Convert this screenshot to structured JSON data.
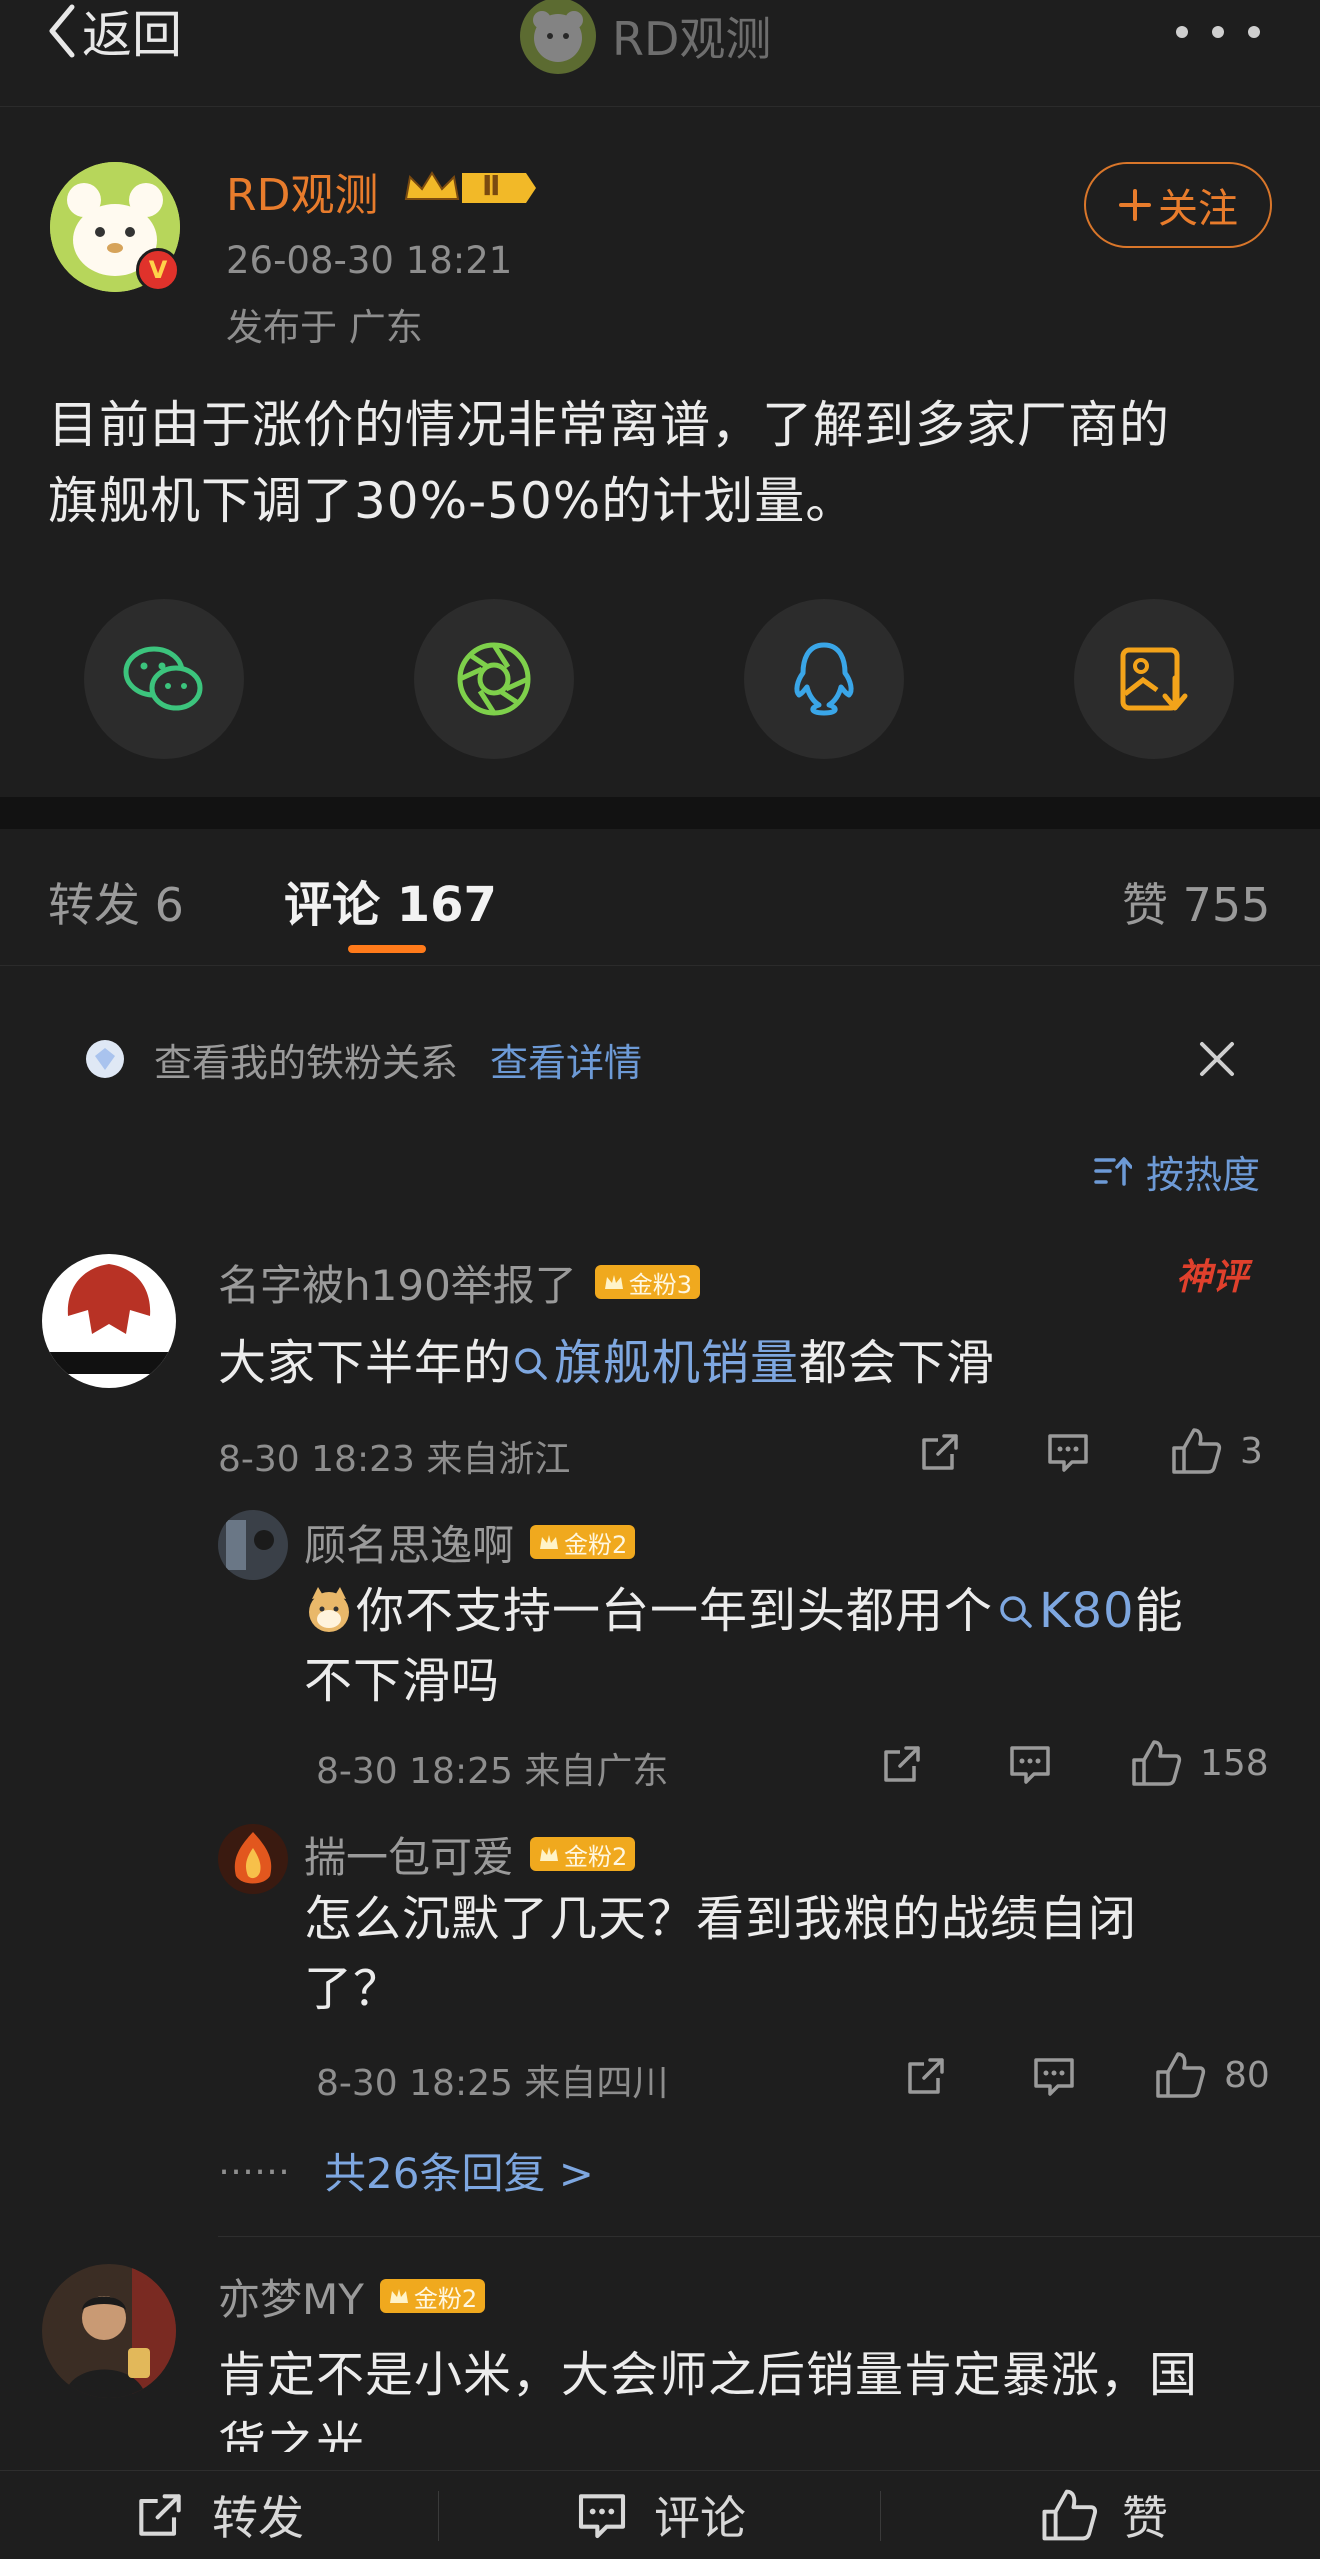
{
  "header": {
    "back_label": "返回",
    "title": "RD观测"
  },
  "post": {
    "author": "RD观测",
    "rank": "Ⅱ",
    "time": "26-08-30 18:21",
    "location": "发布于 广东",
    "follow_label": "关注",
    "text_line1": "目前由于涨价的情况非常离谱，了解到多家厂商的",
    "text_line2": "旗舰机下调了30%-50%的计划量。",
    "share_targets": [
      "wechat-icon",
      "moments-icon",
      "qq-icon",
      "save-image-icon"
    ]
  },
  "tabs": {
    "repost": "转发 6",
    "comment": "评论 167",
    "like": "赞 755"
  },
  "fan_notice": {
    "text": "查看我的铁粉关系",
    "link": "查看详情"
  },
  "sort_label": "按热度",
  "comments": [
    {
      "user": "名字被h190举报了",
      "badge": "金粉3",
      "tag": "神评",
      "text_pre": "大家下半年的",
      "topic": "旗舰机销量",
      "text_post": "都会下滑",
      "meta": "8-30 18:23 来自浙江",
      "likes": "3",
      "replies": [
        {
          "user": "顾名思逸啊",
          "badge": "金粉2",
          "text_line1_pre": "你不支持一台一年到头都用个",
          "topic": "K80",
          "text_line1_post": "能",
          "text_line2": "不下滑吗",
          "meta": "8-30 18:25 来自广东",
          "likes": "158"
        },
        {
          "user": "揣一包可爱",
          "badge": "金粉2",
          "text_line1": "怎么沉默了几天？看到我粮的战绩自闭",
          "text_line2": "了？",
          "meta": "8-30 18:25 来自四川",
          "likes": "80"
        }
      ],
      "more_dots": "……",
      "more_replies": "共26条回复 >"
    },
    {
      "user": "亦梦MY",
      "badge": "金粉2",
      "text_line1": "肯定不是小米，大会师之后销量肯定暴涨，国",
      "text_line2": "货之光"
    }
  ],
  "bottom_bar": {
    "repost": "转发",
    "comment": "评论",
    "like": "赞"
  },
  "colors": {
    "accent": "#e87c2c",
    "link": "#7ea7e0",
    "background": "#1e1e1e"
  }
}
